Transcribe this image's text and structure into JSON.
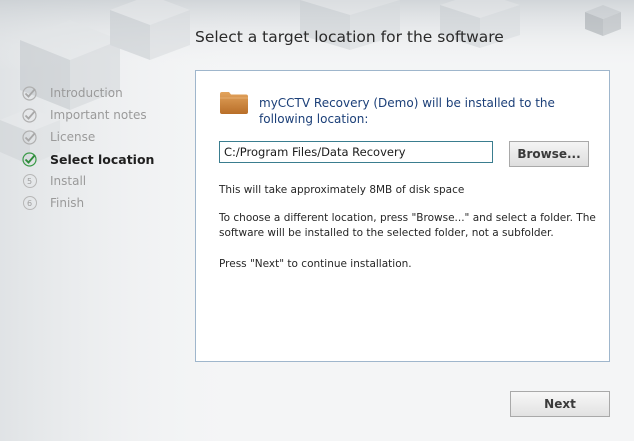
{
  "header": {
    "title": "Select a target location for the software"
  },
  "steps": [
    {
      "label": "Introduction",
      "state": "done",
      "icon": "check-icon"
    },
    {
      "label": "Important notes",
      "state": "done",
      "icon": "check-icon"
    },
    {
      "label": "License",
      "state": "done",
      "icon": "check-icon"
    },
    {
      "label": "Select location",
      "state": "current",
      "icon": "check-icon"
    },
    {
      "label": "Install",
      "state": "pending",
      "number": "5"
    },
    {
      "label": "Finish",
      "state": "pending",
      "number": "6"
    }
  ],
  "panel": {
    "icon": "folder-icon",
    "message": "myCCTV Recovery (Demo) will be installed to the following location:",
    "path_value": "C:/Program Files/Data Recovery",
    "browse_label": "Browse...",
    "disk_space": "This will take approximately 8MB of disk space",
    "choose_hint": "To choose a different location, press \"Browse...\" and select a folder. The software will be installed to the selected folder, not a subfolder.",
    "continue_hint": "Press \"Next\" to continue installation."
  },
  "footer": {
    "next_label": "Next"
  },
  "colors": {
    "accent": "#1b3f78",
    "check_done": "#a8a8a8",
    "check_current": "#2e8b3a",
    "panel_border": "#9fb6cc"
  }
}
